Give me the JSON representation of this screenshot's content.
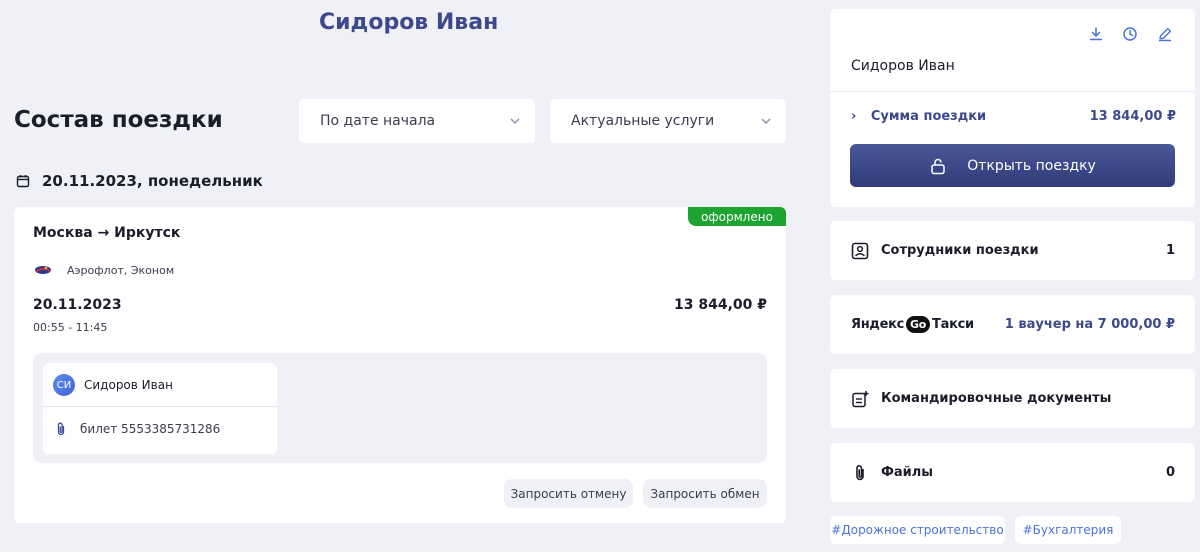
{
  "header": {
    "title": "Сидоров Иван"
  },
  "trip": {
    "section_title": "Состав поездки",
    "filters": {
      "sort": "По дате начала",
      "services": "Актуальные услуги"
    },
    "date_heading": "20.11.2023, понедельник",
    "segment": {
      "status": "оформлено",
      "route": "Москва → Иркутск",
      "airline": "Аэрофлот, Эконом",
      "date": "20.11.2023",
      "time": "00:55 - 11:45",
      "price": "13 844,00 ₽",
      "traveler": {
        "initials": "СИ",
        "name": "Сидоров Иван",
        "ticket": "билет 5553385731286"
      },
      "actions": {
        "cancel": "Запросить отмену",
        "exchange": "Запросить обмен"
      }
    }
  },
  "sidebar": {
    "name": "Сидоров Иван",
    "icons": [
      "download-icon",
      "history-icon",
      "edit-icon"
    ],
    "sum": {
      "label": "Сумма поездки",
      "value": "13 844,00 ₽"
    },
    "open_button": "Открыть поездку",
    "employees": {
      "label": "Сотрудники поездки",
      "value": "1"
    },
    "taxi": {
      "brand_left": "Яндекс",
      "brand_go": "Go",
      "brand_right": "Такси",
      "value": "1 ваучер на 7 000,00 ₽"
    },
    "documents": {
      "label": "Командировочные документы"
    },
    "files": {
      "label": "Файлы",
      "value": "0"
    },
    "tags": [
      "#Дорожное строительство",
      "#Бухгалтерия"
    ]
  },
  "colors": {
    "accent": "#3c4a8c",
    "status_green": "#1da32f",
    "tag_blue": "#4a74d8",
    "background": "#f0f1f6"
  }
}
